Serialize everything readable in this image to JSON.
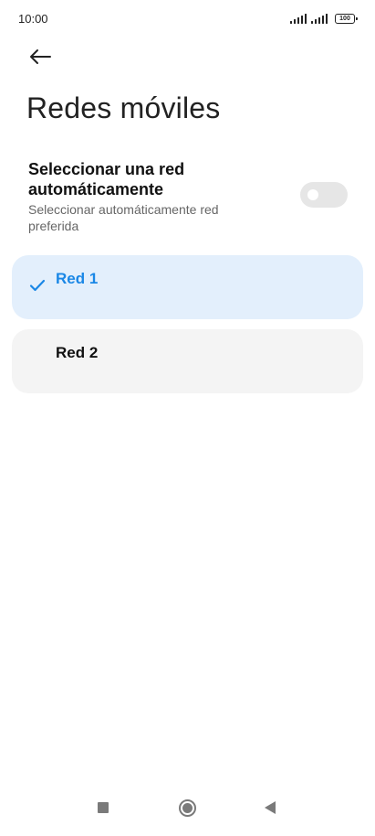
{
  "status_bar": {
    "time": "10:00",
    "battery_level": "100",
    "icons": [
      "signal-icon",
      "signal-icon",
      "battery-icon"
    ]
  },
  "header": {
    "back_icon": "arrow-left-icon",
    "title": "Redes móviles"
  },
  "auto_select": {
    "title": "Seleccionar una red automáticamente",
    "subtitle": "Seleccionar automáticamente red preferida",
    "enabled": false
  },
  "networks": [
    {
      "label": "Red 1",
      "selected": true,
      "icon": "check-icon"
    },
    {
      "label": "Red 2",
      "selected": false
    }
  ],
  "colors": {
    "accent": "#1a87e6",
    "selected_background": "#e3effc",
    "item_background": "#f4f4f4",
    "toggle_off": "#e6e6e6"
  },
  "nav_bar": {
    "icons": [
      "recent-apps-icon",
      "home-icon",
      "back-triangle-icon"
    ]
  }
}
